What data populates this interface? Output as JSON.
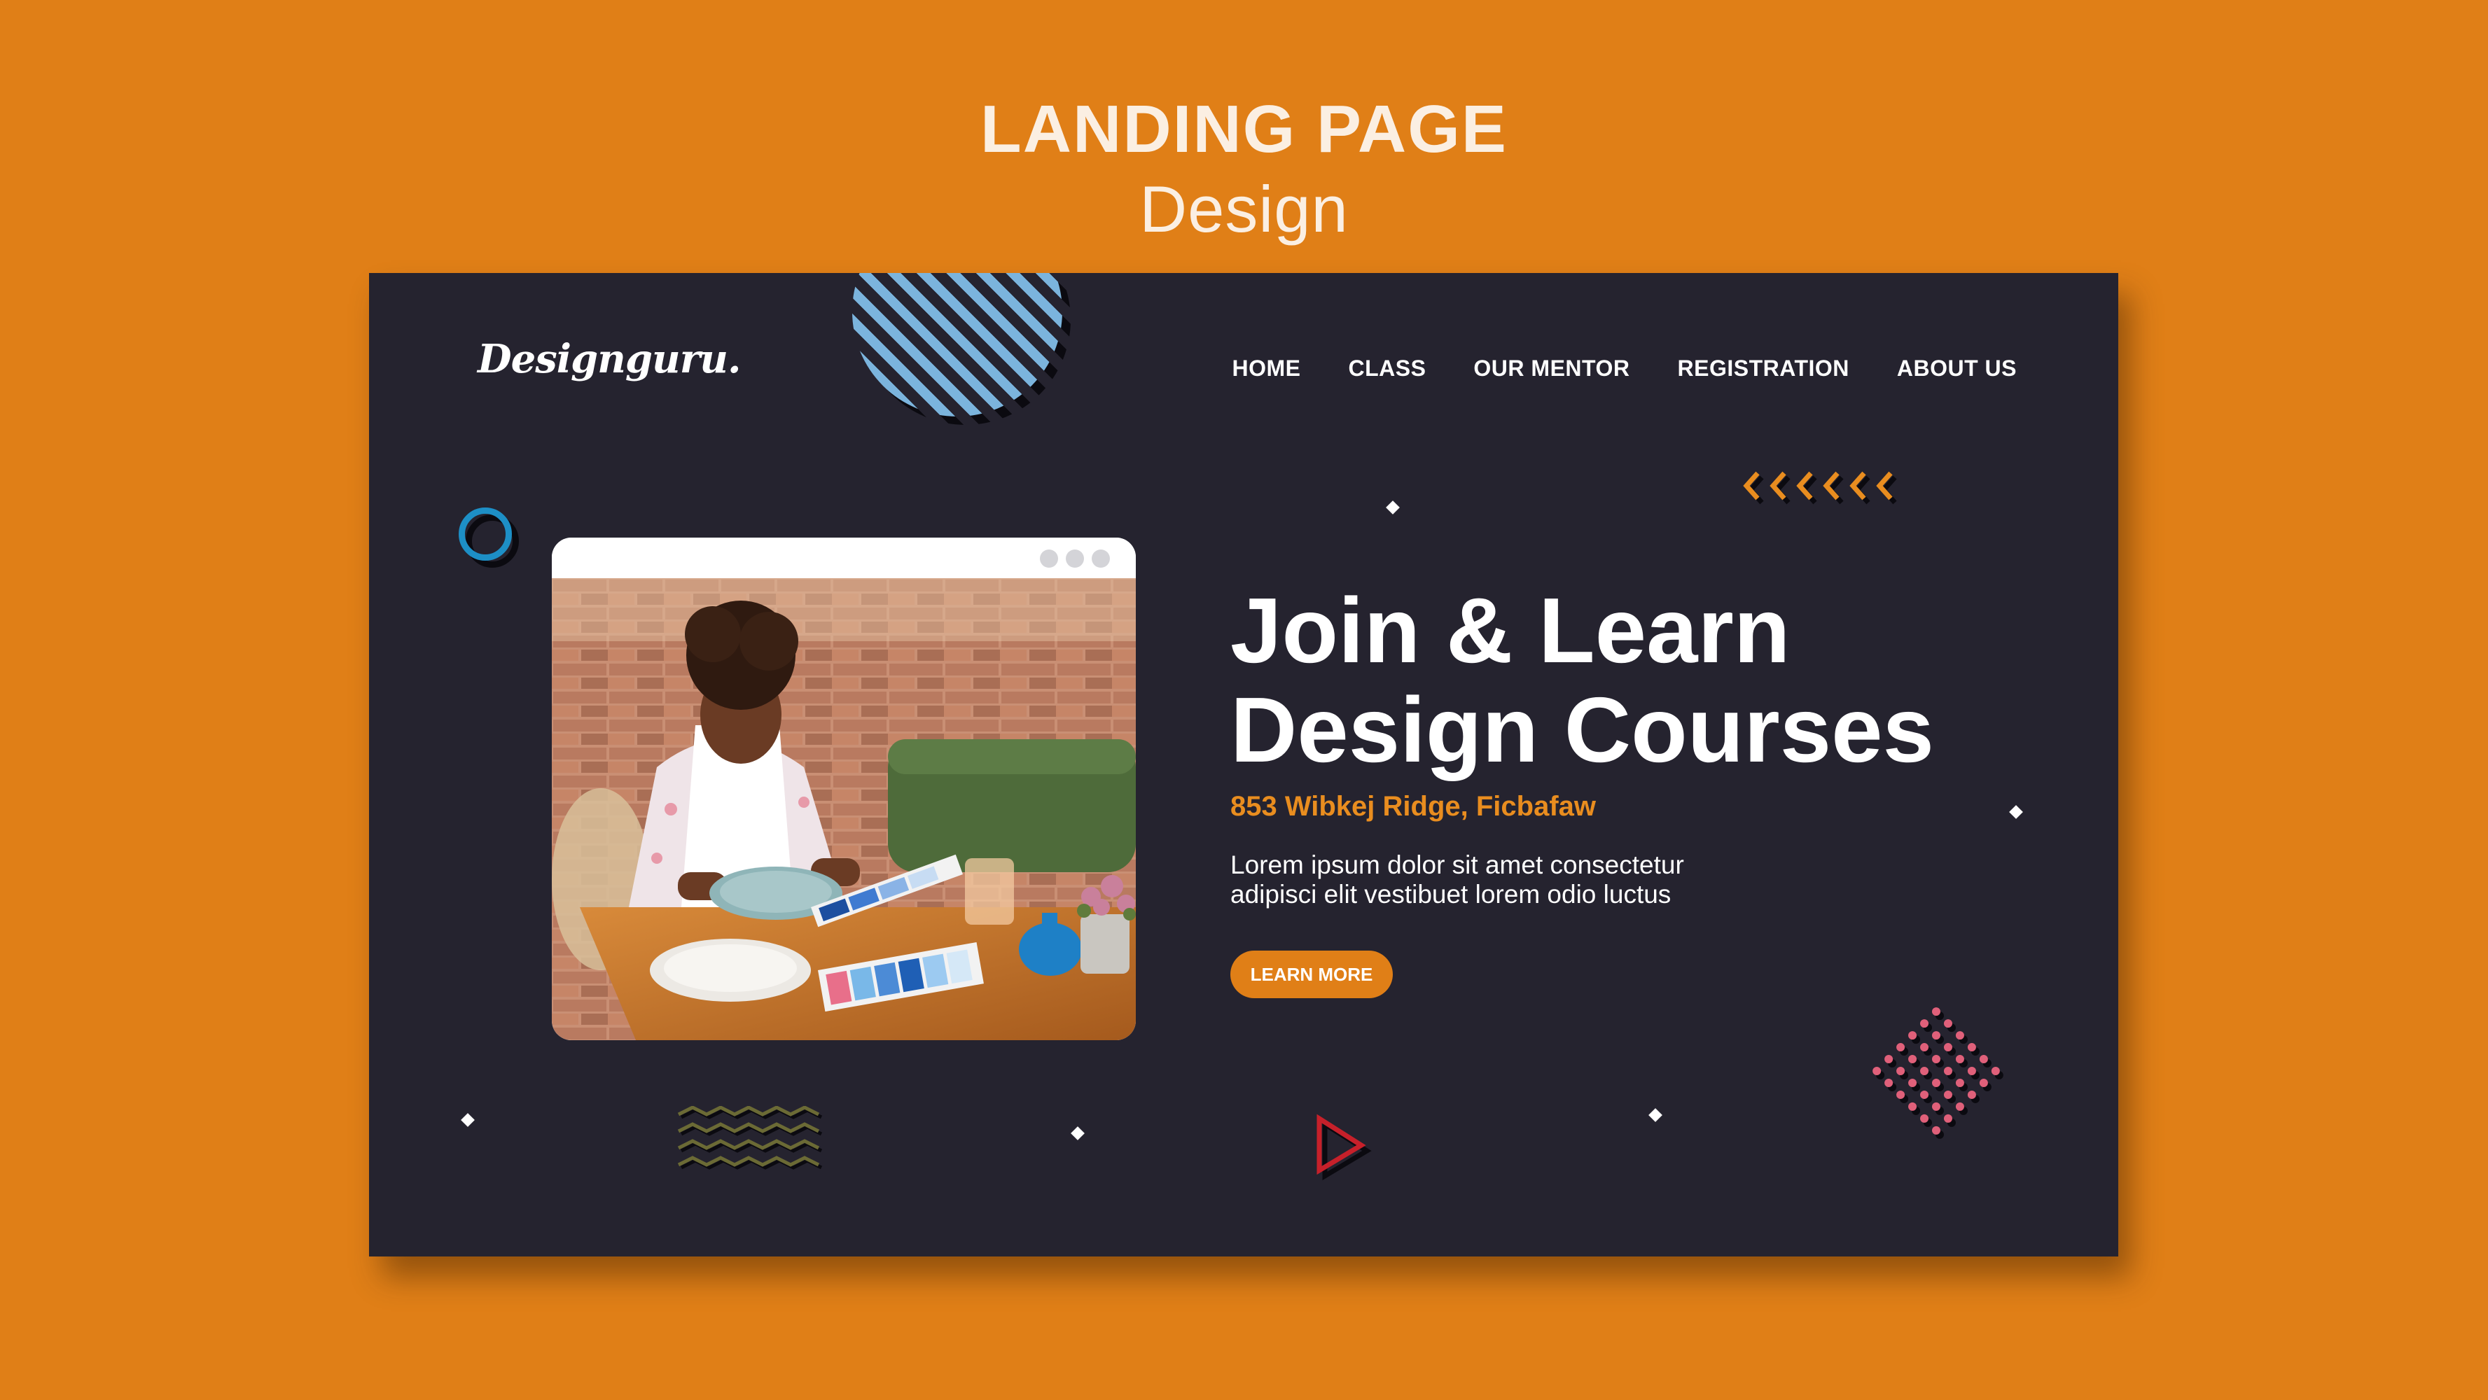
{
  "header": {
    "title": "LANDING PAGE",
    "subtitle": "Design"
  },
  "site": {
    "logo": "Designguru.",
    "nav": [
      "HOME",
      "CLASS",
      "OUR MENTOR",
      "REGISTRATION",
      "ABOUT US"
    ]
  },
  "hero": {
    "title_line1": "Join & Learn",
    "title_line2": "Design Courses",
    "address": "853 Wibkej Ridge, Ficbafaw",
    "desc_line1": "Lorem ipsum dolor sit amet consectetur",
    "desc_line2": "adipisci elit vestibuet lorem odio luctus",
    "cta": "LEARN MORE"
  },
  "colors": {
    "page_background": "#e07f17",
    "card_background": "#25232f",
    "accent_orange": "#e98d1f",
    "accent_blue": "#7bb4dd",
    "ring_blue": "#1d8fc6",
    "dots_pink": "#e0607a",
    "zigzag_olive": "#6b6a35",
    "triangle_red": "#c6202a"
  },
  "icons": [
    "window-dots-icon",
    "chevrons-left-icon",
    "ring-icon",
    "zigzag-icon",
    "triangle-play-icon",
    "dot-grid-icon",
    "diamond-sparkle-icon"
  ]
}
